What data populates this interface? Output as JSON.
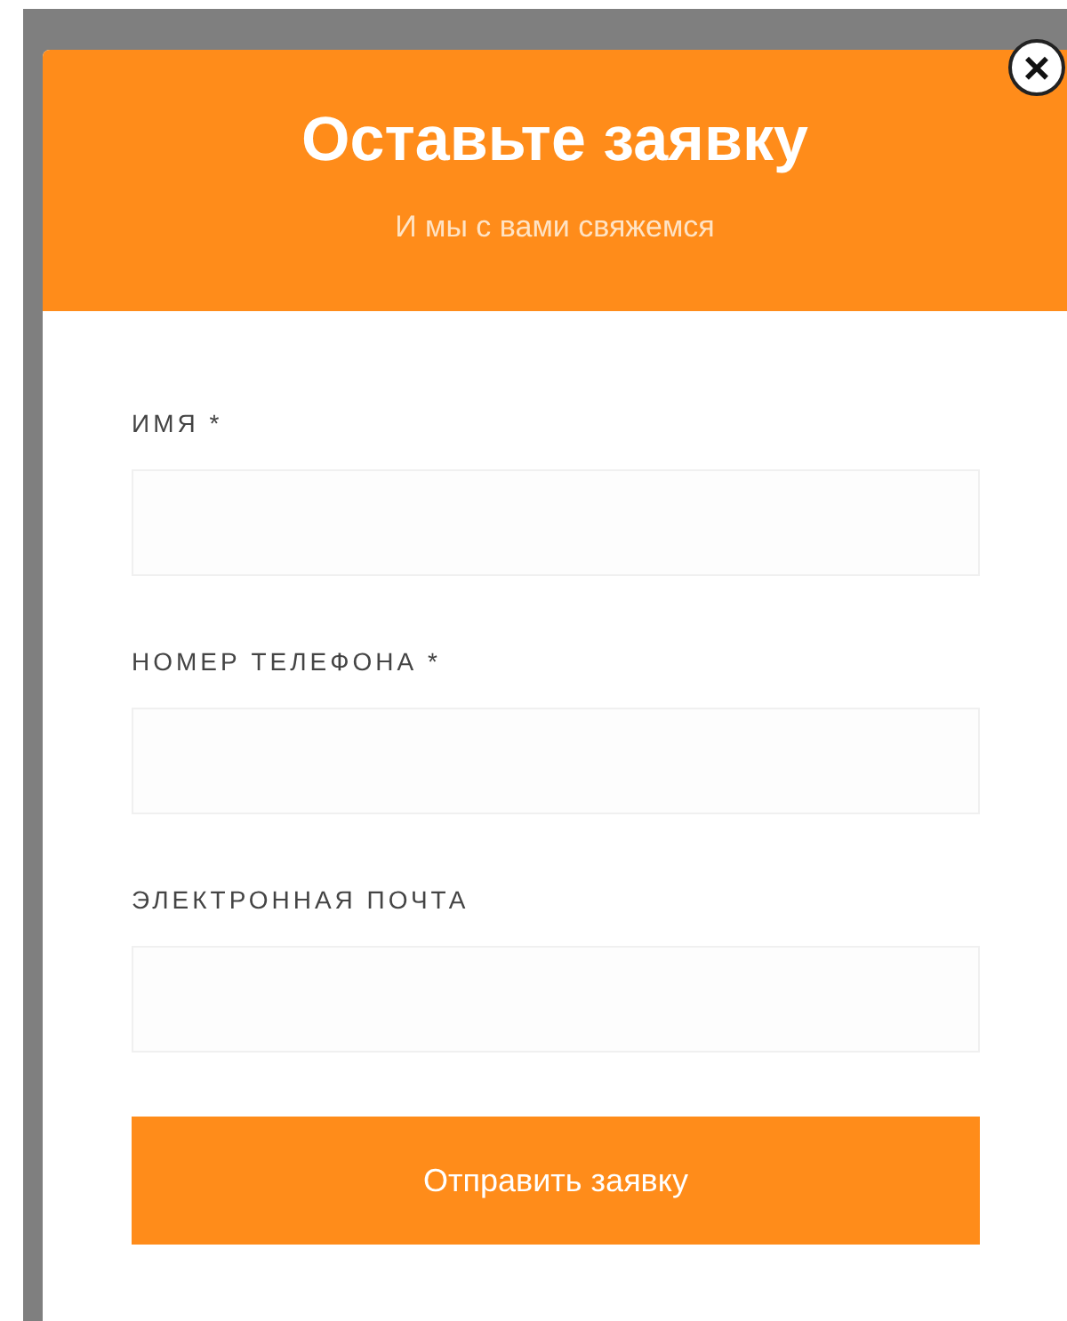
{
  "dialog": {
    "title": "Оставьте заявку",
    "subtitle": "И мы с вами свяжемся",
    "close": "×"
  },
  "fields": [
    {
      "label": "ИМЯ *"
    },
    {
      "label": "НОМЕР ТЕЛЕФОНА *"
    },
    {
      "label": "ЭЛЕКТРОННАЯ ПОЧТА"
    }
  ],
  "submit": "Отправить заявку"
}
